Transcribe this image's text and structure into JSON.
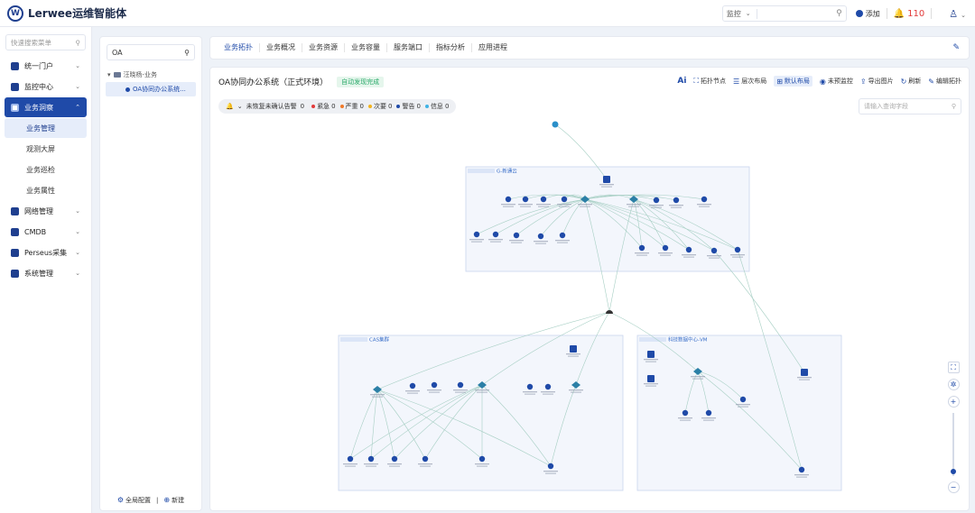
{
  "app": {
    "title": "Lerwee运维智能体",
    "logo_letter": "W"
  },
  "topbar": {
    "search_type": "监控",
    "add_label": "添加",
    "alarm_count": "110"
  },
  "sidebar": {
    "search_placeholder": "快速搜索菜单",
    "items": [
      {
        "label": "统一门户",
        "has_children": true
      },
      {
        "label": "监控中心",
        "has_children": true
      },
      {
        "label": "业务洞察",
        "has_children": true,
        "active": true,
        "children": [
          "业务管理",
          "观测大屏",
          "业务巡检",
          "业务属性"
        ]
      },
      {
        "label": "网络管理",
        "has_children": true
      },
      {
        "label": "CMDB",
        "has_children": true
      },
      {
        "label": "Perseus采集",
        "has_children": true
      },
      {
        "label": "系统管理",
        "has_children": true
      }
    ],
    "active_child": "业务管理"
  },
  "tree": {
    "search_value": "OA",
    "group": "汪晓杨-业务",
    "leaf": "OA协同办公系统...",
    "footer_config": "全局配置",
    "footer_new": "新建"
  },
  "tabs": [
    "业务拓扑",
    "业务概况",
    "业务资源",
    "业务容量",
    "服务端口",
    "指标分析",
    "应用进程"
  ],
  "active_tab": "业务拓扑",
  "main": {
    "title": "OA协同办公系统（正式环境）",
    "badge": "自动发现完成",
    "toolbar": {
      "ai": "Ai",
      "topo_node": "拓扑节点",
      "layer_layout": "层次布局",
      "default_layout": "默认布局",
      "unmonitored": "未预监控",
      "export": "导出图片",
      "refresh": "刷新",
      "edit": "编辑拓扑"
    },
    "status": {
      "unack_prefix": "未恢复未确认告警",
      "unack": "0",
      "items": [
        {
          "label": "紧急",
          "count": "0",
          "color": "#e23a3a"
        },
        {
          "label": "严重",
          "count": "0",
          "color": "#f07a2a"
        },
        {
          "label": "次要",
          "count": "0",
          "color": "#f2b31c"
        },
        {
          "label": "警告",
          "count": "0",
          "color": "#1f4aa8"
        },
        {
          "label": "信息",
          "count": "0",
          "color": "#3fb3e6"
        }
      ]
    },
    "field_search_placeholder": "请输入查询字段",
    "zones": [
      {
        "label": "G-新通云"
      },
      {
        "label": "CAS集群"
      },
      {
        "label": "科技数据中心-VM"
      }
    ]
  },
  "colors": {
    "primary": "#1f4aa8",
    "node": "#1f4aa8",
    "link": "#a7cfc4",
    "zone_fill": "#f3f6fc",
    "zone_border": "#c9d6ee"
  }
}
